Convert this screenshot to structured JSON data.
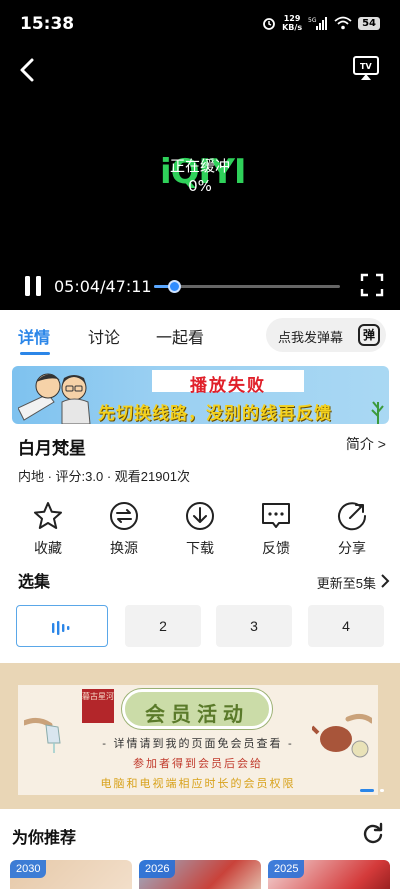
{
  "status_bar": {
    "time": "15:38",
    "net_speed_value": "129",
    "net_speed_unit": "KB/s",
    "network": "5G",
    "battery": "54"
  },
  "player": {
    "logo_text": "iQIYI",
    "buffering_text": "正在缓冲",
    "buffering_percent": "0%",
    "time_display": "05:04/47:11",
    "progress_fraction": 0.107
  },
  "tabs": {
    "items": [
      "详情",
      "讨论",
      "一起看"
    ],
    "active_index": 0,
    "danmu_prompt": "点我发弹幕",
    "danmu_icon": "弹"
  },
  "fail_banner": {
    "title": "播放失败",
    "subtitle": "先切换线路，没别的线再反馈"
  },
  "show": {
    "title": "白月梵星",
    "intro_link": "简介 >",
    "meta": "内地 · 评分:3.0 · 观看21901次"
  },
  "actions": [
    {
      "label": "收藏",
      "icon": "star-icon"
    },
    {
      "label": "换源",
      "icon": "swap-icon"
    },
    {
      "label": "下载",
      "icon": "download-icon"
    },
    {
      "label": "反馈",
      "icon": "feedback-icon"
    },
    {
      "label": "分享",
      "icon": "share-icon"
    }
  ],
  "episodes": {
    "title": "选集",
    "update_text": "更新至5集",
    "items": [
      "2",
      "3",
      "4"
    ]
  },
  "member_banner": {
    "title": "会员活动",
    "stamp": "暮古星河",
    "line1": "- 详情请到我的页面免会员查看 -",
    "line2": "参加者得到会员后会给",
    "line3": "电脑和电视端相应时长的会员权限"
  },
  "recommend": {
    "title": "为你推荐",
    "cards": [
      {
        "year": "2030"
      },
      {
        "year": "2026"
      },
      {
        "year": "2025"
      }
    ]
  },
  "colors": {
    "accent": "#2b86e8",
    "player_bg": "#000000",
    "logo_green": "#2fd15a",
    "fail_red": "#e0202a",
    "fail_yellow": "#f4d11d"
  }
}
